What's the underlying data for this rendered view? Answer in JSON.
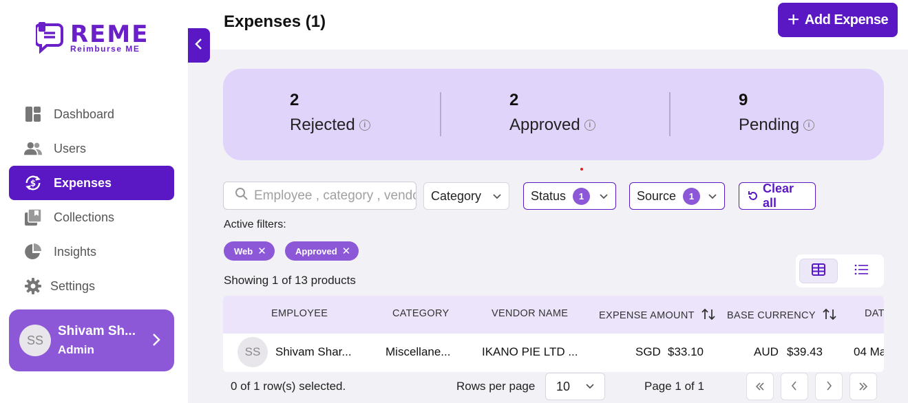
{
  "brand": {
    "name": "REME",
    "tagline": "Reimburse ME"
  },
  "nav": [
    {
      "label": "Dashboard",
      "icon": "dashboard-icon"
    },
    {
      "label": "Users",
      "icon": "users-icon"
    },
    {
      "label": "Expenses",
      "icon": "expenses-icon",
      "active": true
    },
    {
      "label": "Collections",
      "icon": "collections-icon"
    },
    {
      "label": "Insights",
      "icon": "insights-icon"
    },
    {
      "label": "Settings",
      "icon": "gear-icon"
    }
  ],
  "user": {
    "initials": "SS",
    "name": "Shivam Sh...",
    "role": "Admin"
  },
  "header": {
    "title": "Expenses (1)",
    "add_button": "Add Expense"
  },
  "stats": [
    {
      "value": "2",
      "label": "Rejected"
    },
    {
      "value": "2",
      "label": "Approved"
    },
    {
      "value": "9",
      "label": "Pending"
    }
  ],
  "filters": {
    "search_placeholder": "Employee , category , vendor",
    "category_label": "Category",
    "status_label": "Status",
    "status_count": "1",
    "source_label": "Source",
    "source_count": "1",
    "clear_label": "Clear all",
    "active_label": "Active filters:",
    "chips": [
      "Web",
      "Approved"
    ]
  },
  "showing": "Showing 1 of 13 products",
  "table": {
    "columns": [
      "EMPLOYEE",
      "CATEGORY",
      "VENDOR NAME",
      "EXPENSE AMOUNT",
      "BASE CURRENCY",
      "DAT"
    ],
    "rows": [
      {
        "initials": "SS",
        "employee": "Shivam Shar...",
        "category": "Miscellane...",
        "vendor": "IKANO PIE LTD ...",
        "expense_currency": "SGD",
        "expense_amount": "$33.10",
        "base_currency": "AUD",
        "base_amount": "$39.43",
        "date": "04 Ma"
      }
    ]
  },
  "footer": {
    "selected": "0 of 1 row(s) selected.",
    "rows_per_page_label": "Rows per page",
    "rows_per_page": "10",
    "page": "Page 1 of 1"
  },
  "colors": {
    "primary": "#5a17c4",
    "accent": "#8c58d8",
    "stats_bg": "#e1d4fb"
  }
}
